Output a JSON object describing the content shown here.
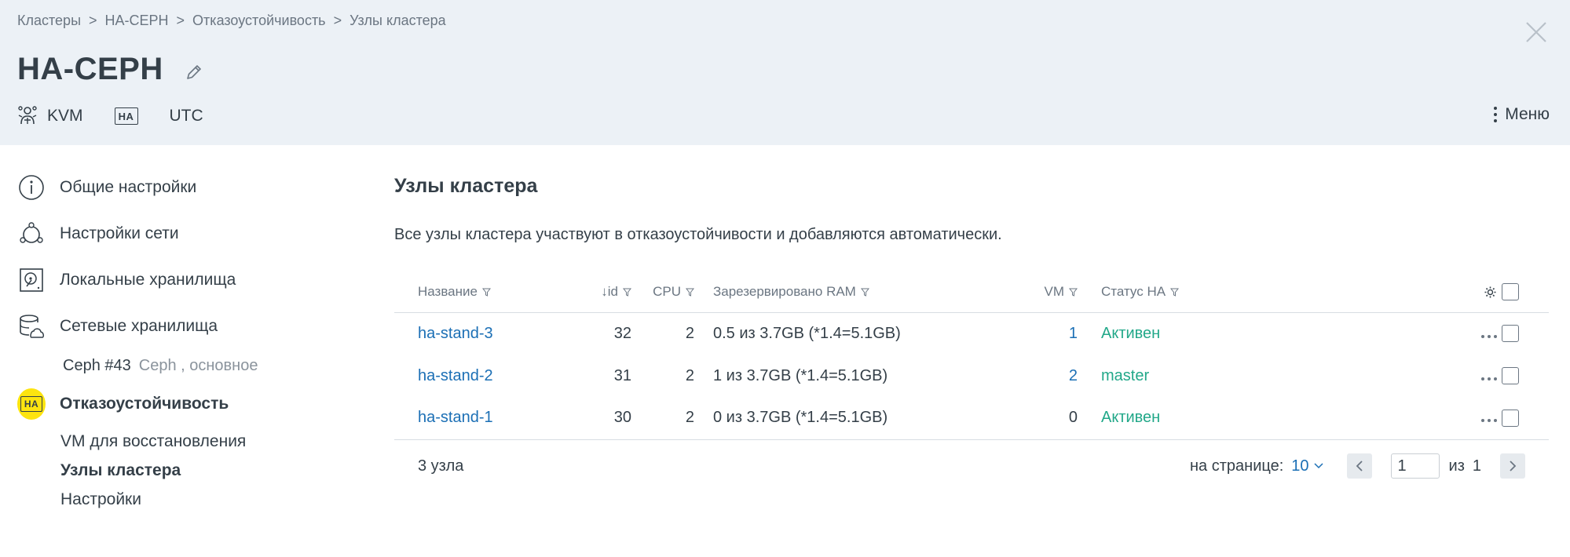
{
  "breadcrumb": {
    "items": [
      "Кластеры",
      "HA-CEPH",
      "Отказоустойчивость",
      "Узлы кластера"
    ],
    "separator": ">"
  },
  "header": {
    "title": "HA-CEPH",
    "virtualization": "KVM",
    "ha_badge": "HA",
    "timezone": "UTC",
    "menu_label": "Меню"
  },
  "sidebar": {
    "items": [
      {
        "label": "Общие настройки",
        "icon": "info-icon"
      },
      {
        "label": "Настройки сети",
        "icon": "network-icon"
      },
      {
        "label": "Локальные хранилища",
        "icon": "hdd-icon"
      },
      {
        "label": "Сетевые хранилища",
        "icon": "database-icon"
      },
      {
        "label": "Отказоустойчивость",
        "icon": "ha-icon"
      }
    ],
    "storage_sub": {
      "name": "Ceph #43",
      "desc": "Ceph , основное"
    },
    "ha_sub": [
      "VM для восстановления",
      "Узлы кластера",
      "Настройки"
    ]
  },
  "main": {
    "title": "Узлы кластера",
    "description": "Все узлы кластера участвуют в отказоустойчивости и добавляются автоматически.",
    "columns": {
      "name": "Название",
      "id": "↓id",
      "cpu": "CPU",
      "ram": "Зарезервировано RAM",
      "vm": "VM",
      "status": "Статус HA"
    },
    "rows": [
      {
        "name": "ha-stand-3",
        "id": "32",
        "cpu": "2",
        "ram": "0.5 из 3.7GB (*1.4=5.1GB)",
        "vm": "1",
        "status": "Активен"
      },
      {
        "name": "ha-stand-2",
        "id": "31",
        "cpu": "2",
        "ram": "1 из 3.7GB (*1.4=5.1GB)",
        "vm": "2",
        "status": "master"
      },
      {
        "name": "ha-stand-1",
        "id": "30",
        "cpu": "2",
        "ram": "0 из 3.7GB (*1.4=5.1GB)",
        "vm": "0",
        "status": "Активен"
      }
    ],
    "footer": {
      "count": "3 узла",
      "per_page_label": "на странице:",
      "per_page_value": "10",
      "page": "1",
      "of_label": "из",
      "total_pages": "1"
    }
  },
  "colors": {
    "header_bg": "#ecf1f6",
    "text": "#343f48",
    "link": "#1b6fb5",
    "status_active": "#22a889",
    "ha_highlight": "#fde40f"
  }
}
